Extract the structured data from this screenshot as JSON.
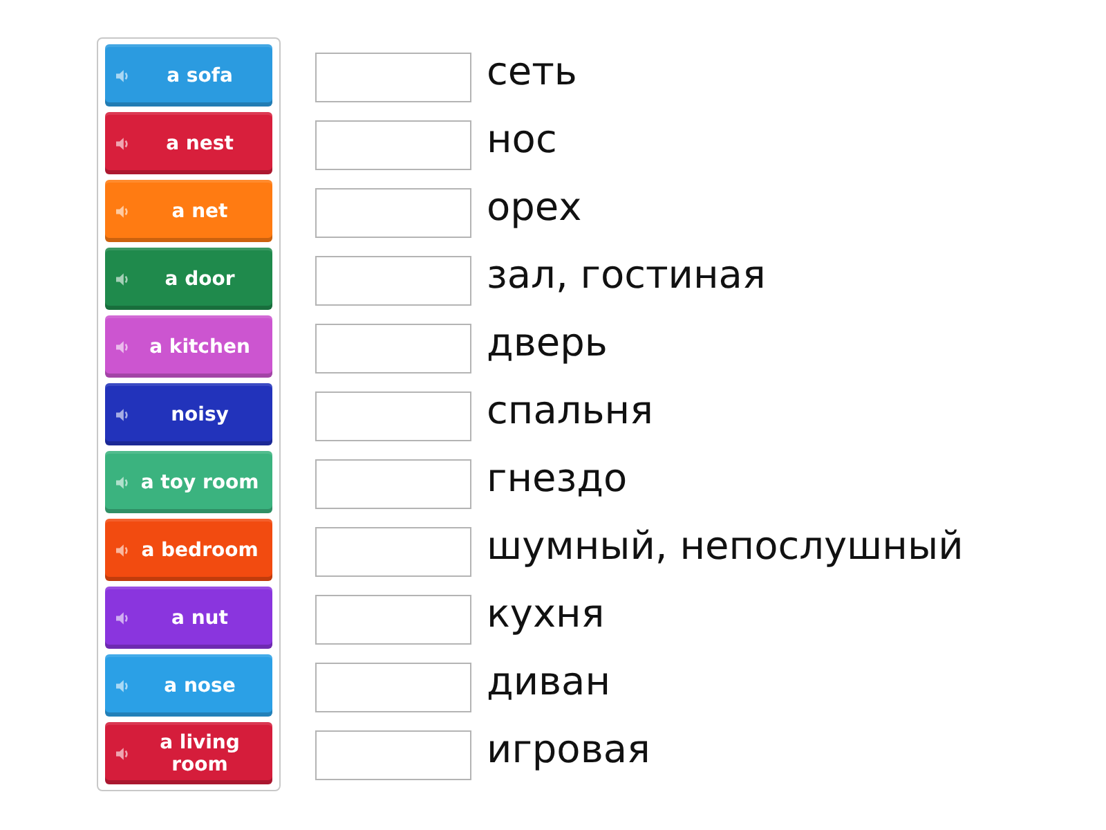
{
  "tiles": [
    {
      "label": "a sofa",
      "color": "#2b9be0"
    },
    {
      "label": "a nest",
      "color": "#d81f3c"
    },
    {
      "label": "a net",
      "color": "#ff7b12"
    },
    {
      "label": "a door",
      "color": "#1f8a4c"
    },
    {
      "label": "a kitchen",
      "color": "#cc55d0"
    },
    {
      "label": "noisy",
      "color": "#2233bb"
    },
    {
      "label": "a toy room",
      "color": "#3bb37f"
    },
    {
      "label": "a bedroom",
      "color": "#f24b10"
    },
    {
      "label": "a nut",
      "color": "#8a35de"
    },
    {
      "label": "a nose",
      "color": "#2ba0e6"
    },
    {
      "label": "a living room",
      "color": "#d51d3b"
    }
  ],
  "answers": [
    {
      "text": "сеть"
    },
    {
      "text": "нос"
    },
    {
      "text": "орех"
    },
    {
      "text": "зал, гостиная"
    },
    {
      "text": "дверь"
    },
    {
      "text": "спальня"
    },
    {
      "text": "гнездо"
    },
    {
      "text": "шумный, непослушный"
    },
    {
      "text": "кухня"
    },
    {
      "text": "диван"
    },
    {
      "text": "игровая"
    }
  ]
}
